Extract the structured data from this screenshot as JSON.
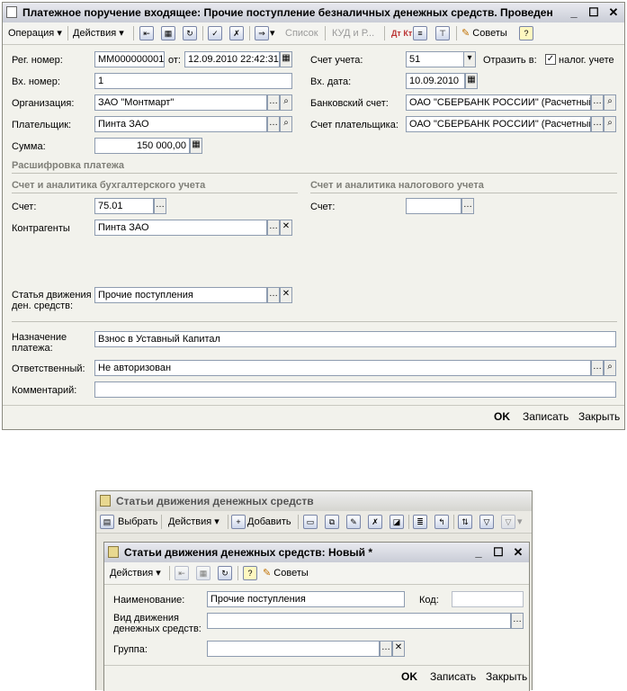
{
  "main_window": {
    "title": "Платежное поручение входящее: Прочие поступление безналичных денежных средств. Проведен",
    "toolbar": {
      "operation": "Операция",
      "actions": "Действия",
      "list": "Список",
      "kud": "КУД и Р...",
      "dtkt": "Дт Кт",
      "tips": "Советы",
      "help": "?"
    },
    "fields": {
      "reg_num_label": "Рег. номер:",
      "reg_num_value": "ММ000000001",
      "from_label": "от:",
      "from_value": "12.09.2010 22:42:31",
      "in_num_label": "Вх. номер:",
      "in_num_value": "1",
      "org_label": "Организация:",
      "org_value": "ЗАО \"Монтмарт\"",
      "payer_label": "Плательщик:",
      "payer_value": "Пинта ЗАО",
      "sum_label": "Сумма:",
      "sum_value": "150 000,00",
      "account_label": "Счет учета:",
      "account_value": "51",
      "reflect_label": "Отразить в:",
      "tax_check_label": "налог. учете",
      "in_date_label": "Вх. дата:",
      "in_date_value": "10.09.2010",
      "bank_label": "Банковский счет:",
      "bank_value": "ОАО \"СБЕРБАНК РОССИИ\" (Расчетный)",
      "payer_acc_label": "Счет плательщика:",
      "payer_acc_value": "ОАО \"СБЕРБАНК РОССИИ\" (Расчетный)"
    },
    "sections": {
      "decoding": "Расшифровка платежа",
      "accounting": "Счет и аналитика бухгалтерского учета",
      "tax": "Счет и аналитика налогового учета"
    },
    "accounting": {
      "account_label": "Счет:",
      "account_value": "75.01",
      "counterparties_label": "Контрагенты",
      "counterparties_value": "Пинта ЗАО",
      "cash_item_label_1": "Статья движения",
      "cash_item_label_2": "ден. средств:",
      "cash_item_value": "Прочие поступления"
    },
    "tax": {
      "account_label": "Счет:",
      "account_value": ""
    },
    "purpose_label_1": "Назначение",
    "purpose_label_2": "платежа:",
    "purpose_value": "Взнос в Уставный Капитал",
    "responsible_label": "Ответственный:",
    "responsible_value": "Не авторизован",
    "comment_label": "Комментарий:",
    "comment_value": "",
    "buttons": {
      "ok": "OK",
      "save": "Записать",
      "close": "Закрыть"
    }
  },
  "list_window": {
    "title": "Статьи движения денежных средств",
    "toolbar": {
      "select": "Выбрать",
      "actions": "Действия",
      "add": "Добавить"
    }
  },
  "new_window": {
    "title": "Статьи движения денежных средств: Новый *",
    "toolbar": {
      "actions": "Действия",
      "help": "?",
      "tips": "Советы"
    },
    "name_label": "Наименование:",
    "name_value": "Прочие поступления",
    "code_label": "Код:",
    "code_value": "",
    "kind_label_1": "Вид движения",
    "kind_label_2": "денежных средств:",
    "kind_value": "",
    "group_label": "Группа:",
    "group_value": "",
    "buttons": {
      "ok": "OK",
      "save": "Записать",
      "close": "Закрыть"
    }
  }
}
